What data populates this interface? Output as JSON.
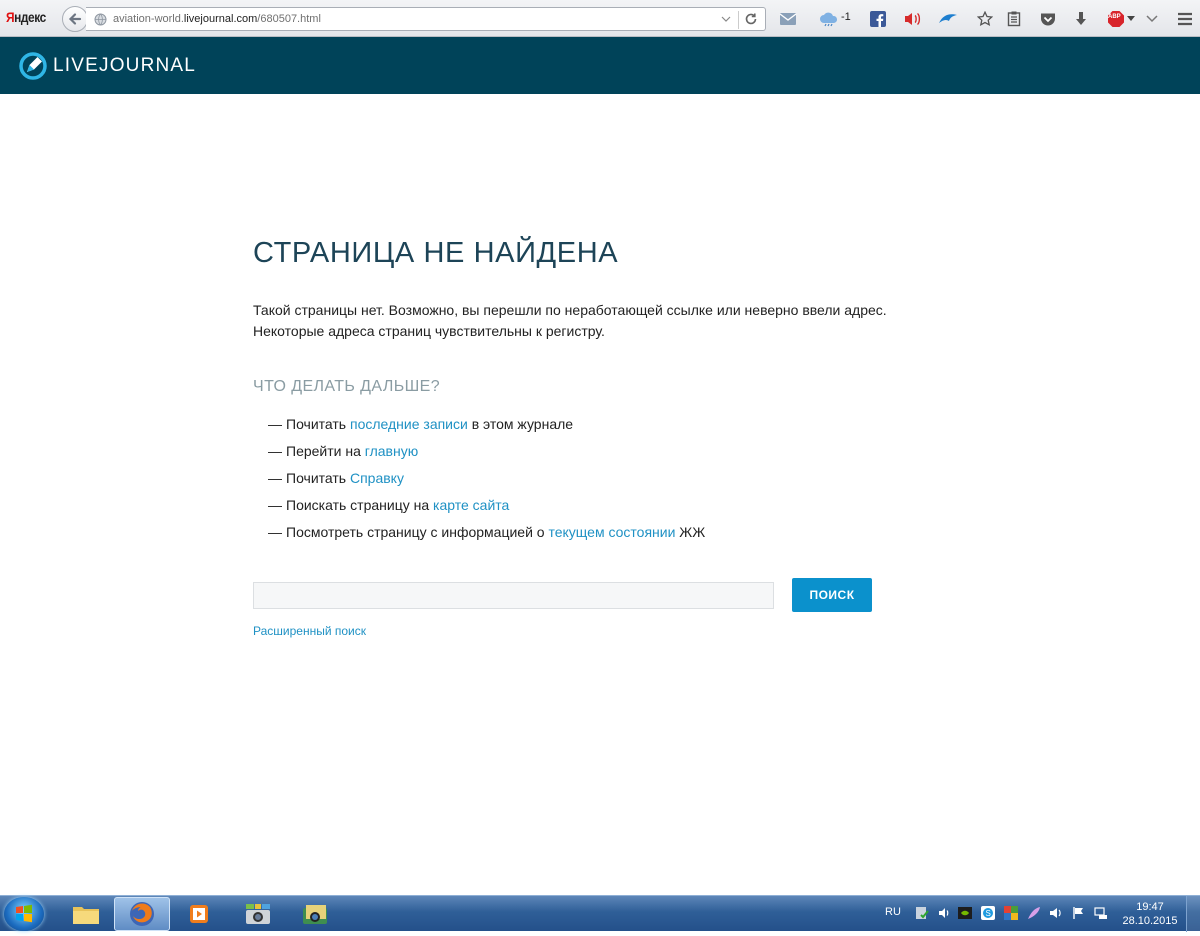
{
  "browser": {
    "brand_y": "Я",
    "brand_rest": "ндекс",
    "url_prefix": "aviation-world.",
    "url_domain": "livejournal.com",
    "url_path": "/680507.html",
    "cloud_count": "-1",
    "abp_label": "ABP"
  },
  "header": {
    "logo_text": "LIVEJOURNAL"
  },
  "main": {
    "title": "СТРАНИЦА НЕ НАЙДЕНА",
    "intro_line1": "Такой страницы нет. Возможно, вы перешли по неработающей ссылке или неверно ввели адрес.",
    "intro_line2": "Некоторые адреса страниц чувствительны к регистру.",
    "next_heading": "ЧТО ДЕЛАТЬ ДАЛЬШЕ?",
    "dash": "—",
    "items": [
      {
        "before": "Почитать ",
        "link": "последние записи",
        "after": " в этом журнале"
      },
      {
        "before": "Перейти на ",
        "link": "главную",
        "after": ""
      },
      {
        "before": "Почитать ",
        "link": "Справку",
        "after": ""
      },
      {
        "before": "Поискать страницу на ",
        "link": "карте сайта",
        "after": ""
      },
      {
        "before": "Посмотреть страницу с информацией о ",
        "link": "текущем состоянии",
        "after": " ЖЖ"
      }
    ],
    "search_value": "",
    "search_button": "ПОИСК",
    "advanced_search": "Расширенный поиск"
  },
  "taskbar": {
    "language": "RU",
    "time": "19:47",
    "date": "28.10.2015"
  },
  "colors": {
    "header_bg": "#004359",
    "title": "#1d4457",
    "link": "#1f91c4",
    "button": "#0b91cc"
  }
}
